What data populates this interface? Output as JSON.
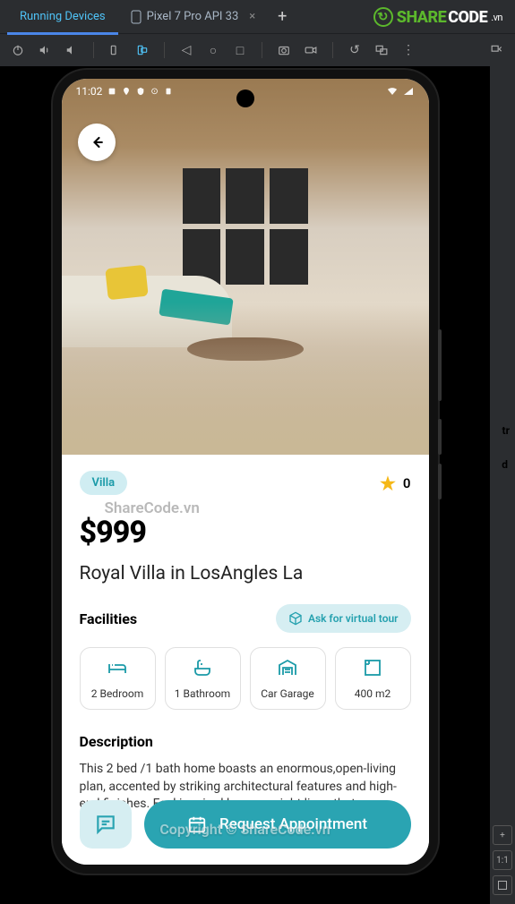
{
  "ide": {
    "tab_running": "Running Devices",
    "tab_pixel": "Pixel 7 Pro API 33",
    "tab_pixel_close": "×",
    "tab_add": "+",
    "right_plus": "+",
    "right_11": "1:1"
  },
  "watermark": {
    "logo_share": "SHARE",
    "logo_code": "CODE",
    "logo_vn": ".vn",
    "center_text": "ShareCode.vn",
    "copyright": "Copyright © ShareCode.vn"
  },
  "sidebits": {
    "tr": "tr",
    "d": "d"
  },
  "status": {
    "time": "11:02"
  },
  "listing": {
    "badge": "Villa",
    "rating_value": "0",
    "price": "$999",
    "title": "Royal Villa in LosAngles La",
    "facilities_label": "Facilities",
    "virtual_tour": "Ask for virtual tour",
    "facilities": [
      {
        "label": "2 Bedroom",
        "icon": "bed-icon"
      },
      {
        "label": "1 Bathroom",
        "icon": "bath-icon"
      },
      {
        "label": "Car Garage",
        "icon": "garage-icon"
      },
      {
        "label": "400 m2",
        "icon": "area-icon"
      }
    ],
    "description_label": "Description",
    "description": "This 2 bed /1 bath home boasts an enormous,open-living plan, accented by striking architectural features and high-end finishes. Feel inspired by open sight lines that",
    "appointment_button": "Request Appointment"
  }
}
